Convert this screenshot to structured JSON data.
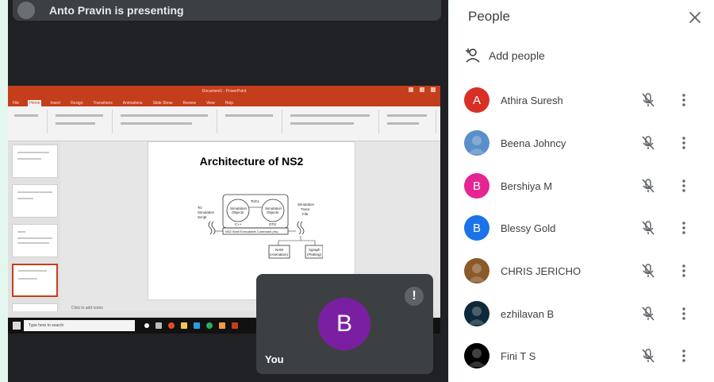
{
  "presenter_bar": {
    "text": "Anto Pravin is presenting"
  },
  "shared_screen": {
    "ppt_title": "Document1 - PowerPoint",
    "ribbon_tabs": [
      "File",
      "Home",
      "Insert",
      "Design",
      "Transitions",
      "Animations",
      "Slide Show",
      "Review",
      "View",
      "Help"
    ],
    "active_tab": "Home",
    "slide_title": "Architecture of NS2",
    "diagram": {
      "left_label": [
        "Tcl",
        "Simulation",
        "Script"
      ],
      "box1": [
        "Simulation",
        "Objects"
      ],
      "box1_caption": "C++",
      "box2": [
        "Simulation",
        "Objects"
      ],
      "box2_caption": "OTcl",
      "link_label": "TclCL",
      "bottom_box": "NS2 Shell Executable Command (ns)",
      "right_label": [
        "Simulation",
        "Trace",
        "File"
      ],
      "out1": [
        "NAM",
        "(Animation)"
      ],
      "out2": [
        "Xgraph",
        "(Plotting)"
      ]
    },
    "notes_placeholder": "Click to add notes",
    "taskbar_search": "Type here to search"
  },
  "self_tile": {
    "avatar_letter": "B",
    "label": "You",
    "more_icon": "!"
  },
  "people_panel": {
    "title": "People",
    "add_people_label": "Add people",
    "participants": [
      {
        "name": "Athira Suresh",
        "avatar_letter": "A",
        "avatar_color": "#d93025",
        "avatar_type": "letter"
      },
      {
        "name": "Beena Johncy",
        "avatar_letter": "",
        "avatar_color": "#5b8fc9",
        "avatar_type": "photo"
      },
      {
        "name": "Bershiya M",
        "avatar_letter": "B",
        "avatar_color": "#e52592",
        "avatar_type": "letter"
      },
      {
        "name": "Blessy Gold",
        "avatar_letter": "B",
        "avatar_color": "#1a73e8",
        "avatar_type": "letter"
      },
      {
        "name": "CHRIS JERICHO",
        "avatar_letter": "",
        "avatar_color": "#8a5a2b",
        "avatar_type": "photo"
      },
      {
        "name": "ezhilavan B",
        "avatar_letter": "",
        "avatar_color": "#0d2a3a",
        "avatar_type": "photo"
      },
      {
        "name": "Fini T S",
        "avatar_letter": "",
        "avatar_color": "#000000",
        "avatar_type": "photo"
      }
    ]
  }
}
